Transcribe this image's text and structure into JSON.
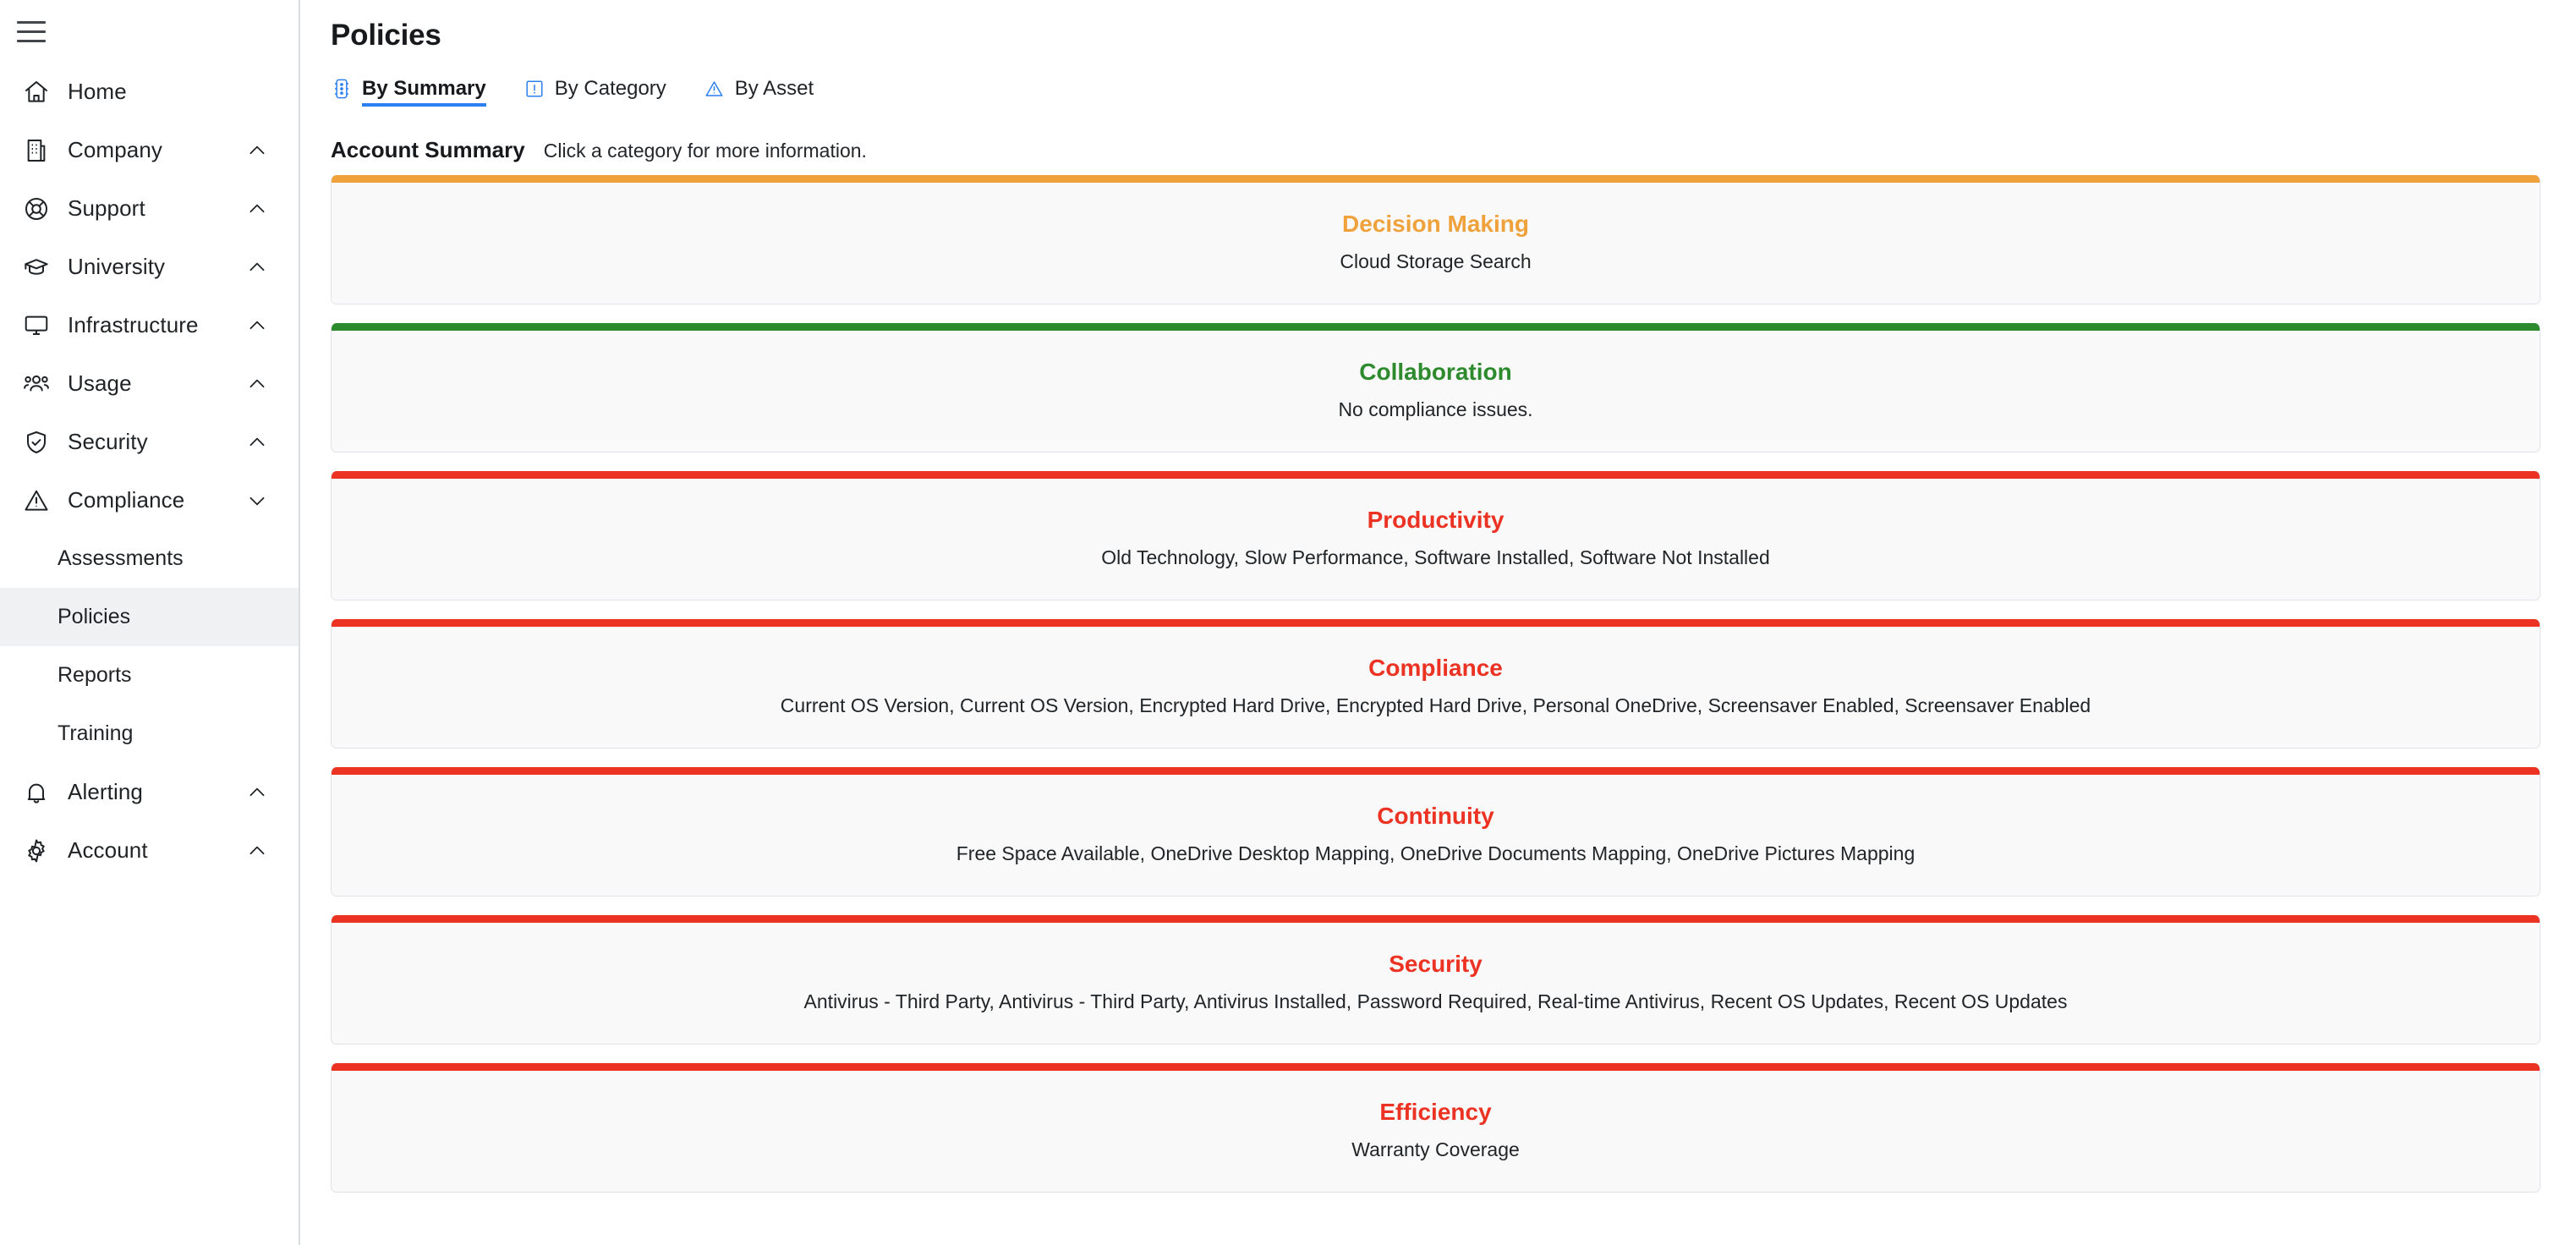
{
  "sidebar": {
    "menu_icon": "hamburger-icon",
    "items": [
      {
        "label": "Home",
        "icon": "home-icon",
        "chevron": null,
        "type": "link"
      },
      {
        "label": "Company",
        "icon": "building-icon",
        "chevron": "up",
        "type": "group"
      },
      {
        "label": "Support",
        "icon": "lifebuoy-icon",
        "chevron": "up",
        "type": "group"
      },
      {
        "label": "University",
        "icon": "graduation-icon",
        "chevron": "up",
        "type": "group"
      },
      {
        "label": "Infrastructure",
        "icon": "monitor-icon",
        "chevron": "up",
        "type": "group"
      },
      {
        "label": "Usage",
        "icon": "users-icon",
        "chevron": "up",
        "type": "group"
      },
      {
        "label": "Security",
        "icon": "shield-check-icon",
        "chevron": "up",
        "type": "group"
      },
      {
        "label": "Compliance",
        "icon": "warning-triangle-icon",
        "chevron": "down",
        "type": "group"
      }
    ],
    "compliance_children": [
      {
        "label": "Assessments",
        "active": false
      },
      {
        "label": "Policies",
        "active": true
      },
      {
        "label": "Reports",
        "active": false
      },
      {
        "label": "Training",
        "active": false
      }
    ],
    "items_after": [
      {
        "label": "Alerting",
        "icon": "bell-icon",
        "chevron": "up",
        "type": "group"
      },
      {
        "label": "Account",
        "icon": "gear-icon",
        "chevron": "up",
        "type": "group"
      }
    ]
  },
  "header": {
    "title": "Policies"
  },
  "tabs": [
    {
      "label": "By Summary",
      "icon": "traffic-light-icon",
      "active": true
    },
    {
      "label": "By Category",
      "icon": "exclamation-box-icon",
      "active": false
    },
    {
      "label": "By Asset",
      "icon": "warning-triangle-icon",
      "active": false
    }
  ],
  "summary": {
    "title": "Account Summary",
    "hint": "Click a category for more information."
  },
  "colors": {
    "orange": "#efa23c",
    "green": "#2d8a2d",
    "red": "#ec3323",
    "accent_blue": "#2d7ff0",
    "card_bg": "#f9f9f9"
  },
  "cards": [
    {
      "name": "Decision Making",
      "status_color": "#efa23c",
      "detail": "Cloud Storage Search"
    },
    {
      "name": "Collaboration",
      "status_color": "#2d8a2d",
      "detail": "No compliance issues."
    },
    {
      "name": "Productivity",
      "status_color": "#ec3323",
      "detail": "Old Technology, Slow Performance, Software Installed, Software Not Installed"
    },
    {
      "name": "Compliance",
      "status_color": "#ec3323",
      "detail": "Current OS Version, Current OS Version, Encrypted Hard Drive, Encrypted Hard Drive, Personal OneDrive, Screensaver Enabled, Screensaver Enabled"
    },
    {
      "name": "Continuity",
      "status_color": "#ec3323",
      "detail": "Free Space Available, OneDrive Desktop Mapping, OneDrive Documents Mapping, OneDrive Pictures Mapping"
    },
    {
      "name": "Security",
      "status_color": "#ec3323",
      "detail": "Antivirus - Third Party, Antivirus - Third Party, Antivirus Installed, Password Required, Real-time Antivirus, Recent OS Updates, Recent OS Updates"
    },
    {
      "name": "Efficiency",
      "status_color": "#ec3323",
      "detail": "Warranty Coverage"
    }
  ]
}
